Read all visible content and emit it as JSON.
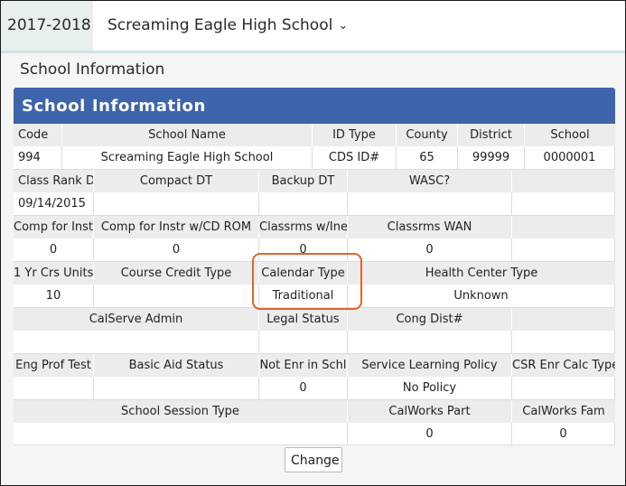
{
  "topbar": {
    "year": "2017-2018",
    "school": "Screaming Eagle High School",
    "chevron_icon": "chevron-down-icon"
  },
  "page_title": "School Information",
  "panel_title": "School Information",
  "rows": {
    "r1_headers": [
      "Code",
      "School Name",
      "ID Type",
      "County",
      "District",
      "School"
    ],
    "r1_values": [
      "994",
      "Screaming Eagle High School",
      "CDS ID#",
      "65",
      "99999",
      "0000001"
    ],
    "r2_headers": [
      "Class Rank DT",
      "Compact DT",
      "Backup DT",
      "WASC?"
    ],
    "r2_values": [
      "09/14/2015",
      "",
      "",
      "",
      ""
    ],
    "r3_headers": [
      "Comp for Instr",
      "Comp for Instr w/CD ROM",
      "Classrms w/Inet",
      "Classrms WAN"
    ],
    "r3_values": [
      "0",
      "0",
      "0",
      "0"
    ],
    "r4_headers": [
      "1 Yr Crs Units",
      "Course Credit Type",
      "Calendar Type",
      "Health Center Type"
    ],
    "r4_values": [
      "10",
      "",
      "Traditional",
      "Unknown"
    ],
    "r5_headers": [
      "CalServe Admin",
      "Legal Status",
      "Cong Dist#"
    ],
    "r5_values": [
      "",
      "",
      "",
      ""
    ],
    "r6_headers": [
      "Eng Prof Test",
      "Basic Aid Status",
      "Not Enr in Schl",
      "Service Learning Policy",
      "CSR Enr Calc Type"
    ],
    "r6_values": [
      "",
      "",
      "0",
      "No Policy",
      ""
    ],
    "r7_headers": [
      "School Session Type",
      "CalWorks Part",
      "CalWorks Fam"
    ],
    "r7_values": [
      "",
      "0",
      "0"
    ]
  },
  "change_button": "Change",
  "colors": {
    "panel_header": "#3e64ac",
    "highlight": "#e0642c",
    "year_tab": "#e8f0ea"
  }
}
